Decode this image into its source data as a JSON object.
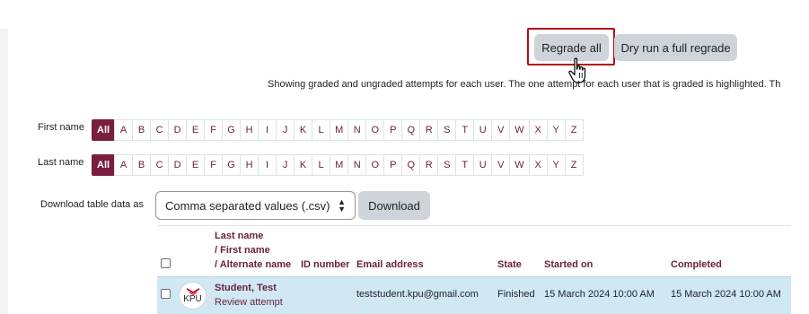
{
  "actions": {
    "regrade_all_label": "Regrade all",
    "dry_run_label": "Dry run a full regrade"
  },
  "info_text": "Showing graded and ungraded attempts for each user. The one attempt for each user that is graded is highlighted. Th",
  "initials": {
    "first_name_label": "First name",
    "last_name_label": "Last name",
    "all_label": "All",
    "letters": [
      "A",
      "B",
      "C",
      "D",
      "E",
      "F",
      "G",
      "H",
      "I",
      "J",
      "K",
      "L",
      "M",
      "N",
      "O",
      "P",
      "Q",
      "R",
      "S",
      "T",
      "U",
      "V",
      "W",
      "X",
      "Y",
      "Z"
    ]
  },
  "download": {
    "label": "Download table data as",
    "selected_format": "Comma separated values (.csv)",
    "button_label": "Download"
  },
  "table": {
    "headers": {
      "name_line1": "Last name",
      "name_line2": "/ First name",
      "name_line3": "/ Alternate name",
      "id_number": "ID number",
      "email": "Email address",
      "state": "State",
      "started_on": "Started on",
      "completed": "Completed"
    },
    "rows": [
      {
        "avatar_text": "KPU",
        "name": "Student, Test",
        "review_link": "Review attempt",
        "id_number": "",
        "email": "teststudent.kpu@gmail.com",
        "state": "Finished",
        "started_on": "15 March 2024 10:00 AM",
        "completed": "15 March 2024 10:00 AM"
      }
    ]
  },
  "colors": {
    "brand": "#7a1e3f",
    "link": "#6a1e3d",
    "highlight_border": "#b30f0f",
    "row_highlight": "#cfe8f3",
    "button_bg": "#ced4da"
  }
}
